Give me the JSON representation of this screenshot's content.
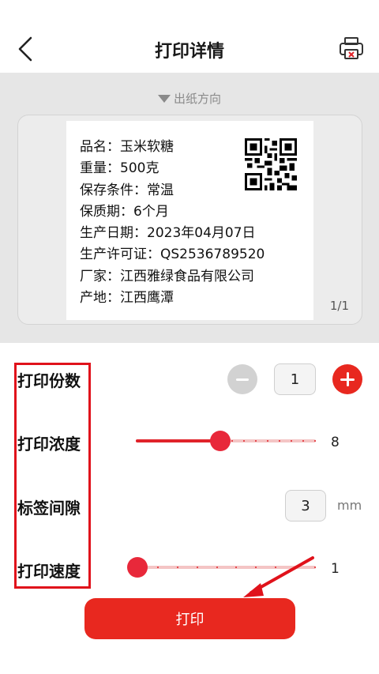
{
  "header": {
    "title": "打印详情",
    "back_icon": "chevron-left-icon",
    "action_icon": "printer-icon"
  },
  "preview": {
    "paper_direction": "出纸方向",
    "page_indicator": "1/1",
    "label_lines": [
      "品名：玉米软糖",
      "重量：500克",
      "保存条件：常温",
      "保质期：6个月",
      "生产日期：2023年04月07日",
      "生产许可证：QS2536789520",
      "厂家：江西雅绿食品有限公司",
      "产地：江西鹰潭"
    ]
  },
  "settings": {
    "copies": {
      "label": "打印份数",
      "value": "1"
    },
    "density": {
      "label": "打印浓度",
      "value": "8",
      "fraction": 0.47
    },
    "gap": {
      "label": "标签间隙",
      "value": "3",
      "unit": "mm"
    },
    "speed": {
      "label": "打印速度",
      "value": "1",
      "fraction": 0.0
    }
  },
  "print_button": {
    "label": "打印"
  },
  "colors": {
    "accent": "#e8281f",
    "highlight": "#e0121b",
    "preview_bg": "#e6e6e6"
  }
}
